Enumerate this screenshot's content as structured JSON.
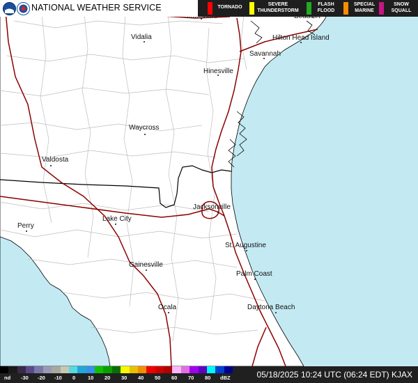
{
  "header": {
    "agency_title": "NATIONAL WEATHER SERVICE",
    "legend": [
      {
        "label": "TORNADO",
        "color": "#ff0000"
      },
      {
        "label": "SEVERE\nTHUNDERSTORM",
        "color": "#ffff00"
      },
      {
        "label": "FLASH\nFLOOD",
        "color": "#22aa22"
      },
      {
        "label": "SPECIAL\nMARINE",
        "color": "#ff8c00"
      },
      {
        "label": "SNOW\nSQUALL",
        "color": "#c71585"
      }
    ]
  },
  "map": {
    "ocean_color": "#c3eaf3",
    "land_color": "#ffffff",
    "county_line_color": "#bdbdbd",
    "state_line_color": "#000000",
    "highway_color": "#8b0000",
    "cities": [
      {
        "name": "Statesboro"
      },
      {
        "name": "Beaufort"
      },
      {
        "name": "Vidalia"
      },
      {
        "name": "Hilton Head Island"
      },
      {
        "name": "Savannah"
      },
      {
        "name": "Hinesville"
      },
      {
        "name": "Waycross"
      },
      {
        "name": "Valdosta"
      },
      {
        "name": "Jacksonville"
      },
      {
        "name": "Perry"
      },
      {
        "name": "Lake City"
      },
      {
        "name": "St. Augustine"
      },
      {
        "name": "Gainesville"
      },
      {
        "name": "Palm Coast"
      },
      {
        "name": "Ocala"
      },
      {
        "name": "Daytona Beach"
      }
    ]
  },
  "footer": {
    "scale_labels": [
      "nd",
      "-30",
      "-20",
      "-10",
      "0",
      "10",
      "20",
      "30",
      "40",
      "50",
      "60",
      "70",
      "80",
      "dBZ"
    ],
    "timestamp": "05/18/2025 10:24 UTC (06:24 EDT)  KJAX"
  }
}
